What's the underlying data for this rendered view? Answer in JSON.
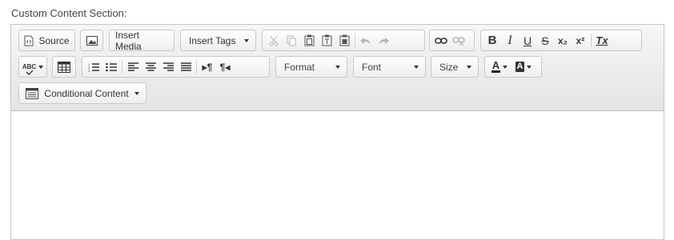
{
  "label": "Custom Content Section:",
  "toolbar": {
    "source_label": "Source",
    "insert_media_label": "Insert Media",
    "insert_tags_label": "Insert Tags",
    "bold_glyph": "B",
    "italic_glyph": "I",
    "underline_glyph": "U",
    "strike_glyph": "S",
    "subscript_glyph": "x₂",
    "superscript_glyph": "x²",
    "remove_format_glyph": "Tx",
    "spell_glyph": "ABC",
    "ltr_glyph": "▸¶",
    "rtl_glyph": "¶◂",
    "format_label": "Format",
    "font_label": "Font",
    "size_label": "Size",
    "text_color_glyph": "A",
    "bg_color_glyph": "A",
    "conditional_content_label": "Conditional Content"
  },
  "icons": [
    "source-icon",
    "image-icon",
    "cut-icon",
    "copy-icon",
    "paste-icon",
    "paste-text-icon",
    "paste-word-icon",
    "undo-icon",
    "redo-icon",
    "link-icon",
    "unlink-icon",
    "spellcheck-icon",
    "table-icon",
    "numbered-list-icon",
    "bulleted-list-icon",
    "align-left-icon",
    "align-center-icon",
    "align-right-icon",
    "justify-icon",
    "ltr-icon",
    "rtl-icon",
    "text-color-icon",
    "background-color-icon",
    "conditional-content-icon"
  ],
  "colors": {
    "toolbar_bg": "#ebebeb",
    "border": "#c6c6c6",
    "text": "#333333",
    "disabled": "#b5b5b5"
  }
}
